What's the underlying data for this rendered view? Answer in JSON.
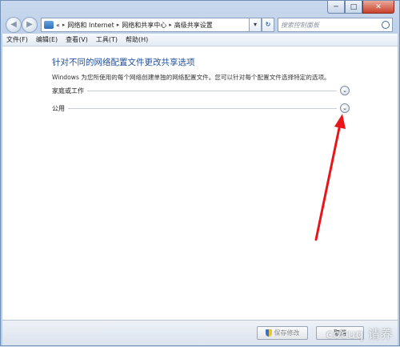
{
  "window": {
    "caption": {
      "minimize": "─",
      "maximize": "□",
      "close": "✕"
    }
  },
  "nav": {
    "back": "◀",
    "forward": "▶",
    "breadcrumb": [
      "«",
      "网络和 Internet",
      "网络和共享中心",
      "高级共享设置"
    ],
    "separator": "▸",
    "dropdown": "▾",
    "refresh": "↻",
    "search_placeholder": "搜索控制面板"
  },
  "menu": [
    "文件(F)",
    "编辑(E)",
    "查看(V)",
    "工具(T)",
    "帮助(H)"
  ],
  "content": {
    "heading": "针对不同的网络配置文件更改共享选项",
    "description": "Windows 为您所使用的每个网络创建单独的网络配置文件。您可以针对每个配置文件选择特定的选项。",
    "profiles": [
      {
        "label": "家庭或工作",
        "expand": "⌄"
      },
      {
        "label": "公用",
        "expand": "⌄"
      }
    ]
  },
  "bottom": {
    "save_button": "保存修改",
    "cancel_button": "取消",
    "watermark": "cocuq 请养"
  },
  "colors": {
    "heading": "#1e4f9a",
    "annotation_arrow": "#e8161b"
  },
  "icons": [
    "folder-icon",
    "search-icon",
    "chevron-down-icon",
    "shield-icon",
    "refresh-icon"
  ]
}
